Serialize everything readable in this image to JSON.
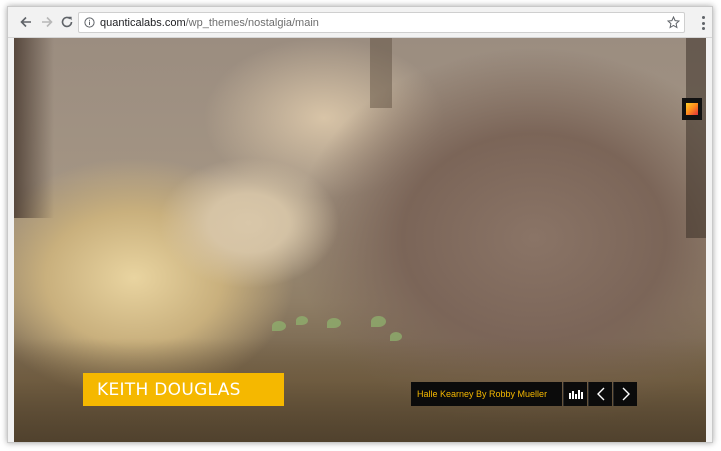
{
  "browser": {
    "url_host": "quanticalabs.com",
    "url_path": "/wp_themes/nostalgia/main",
    "icons": {
      "back": "arrow-left-icon",
      "forward": "arrow-right-icon",
      "reload": "reload-icon",
      "info": "info-icon",
      "bookmark": "star-icon",
      "menu": "kebab-menu-icon"
    }
  },
  "slide": {
    "title": "KEITH DOUGLAS",
    "caption": "Halle Kearney By Robby Mueller",
    "accent_color": "#f5b800",
    "controls": [
      "equalizer-icon",
      "chevron-left-icon",
      "chevron-right-icon"
    ]
  },
  "side_widget": {
    "icon": "color-swatch-icon"
  }
}
